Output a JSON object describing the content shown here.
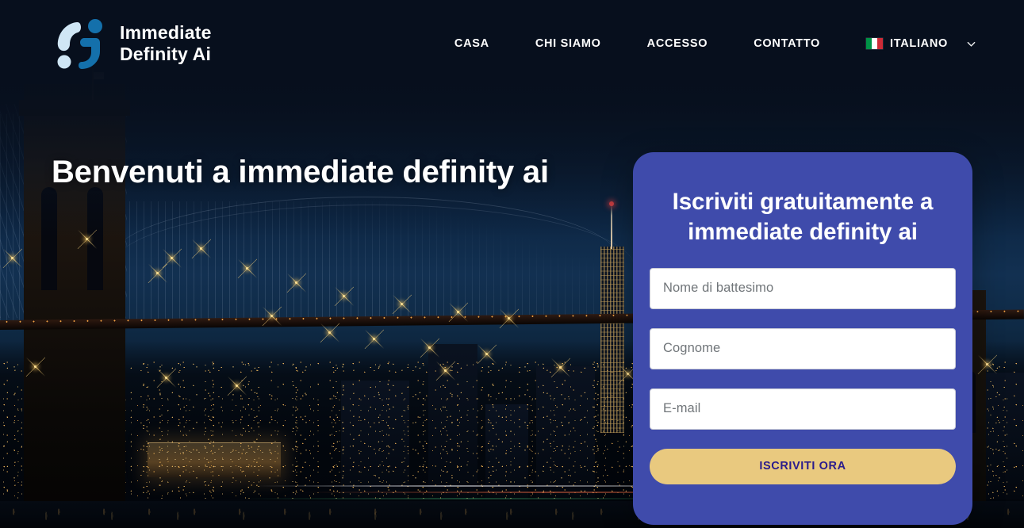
{
  "brand": {
    "name_line1": "Immediate",
    "name_line2": "Definity Ai",
    "logo_icon": "immediate-definity-logo-icon"
  },
  "nav": {
    "items": [
      {
        "label": "CASA",
        "name": "nav-item-casa"
      },
      {
        "label": "CHI SIAMO",
        "name": "nav-item-chi-siamo"
      },
      {
        "label": "ACCESSO",
        "name": "nav-item-accesso"
      },
      {
        "label": "CONTATTO",
        "name": "nav-item-contatto"
      }
    ],
    "language": {
      "label": "ITALIANO",
      "flag_icon": "italian-flag-icon",
      "chevron_icon": "chevron-down-icon"
    }
  },
  "hero": {
    "title": "Benvenuti a immediate definity ai",
    "background_image": "new-york-brooklyn-bridge-night-skyline"
  },
  "signup": {
    "title": "Iscriviti gratuitamente a immediate definity ai",
    "fields": [
      {
        "placeholder": "Nome di battesimo",
        "value": "",
        "name": "first-name-field"
      },
      {
        "placeholder": "Cognome",
        "value": "",
        "name": "last-name-field"
      },
      {
        "placeholder": "E-mail",
        "value": "",
        "name": "email-field"
      }
    ],
    "cta_label": "ISCRIVITI ORA"
  },
  "colors": {
    "header_background": "#070f1d",
    "card_background": "#3f4bab",
    "cta_background": "#e9c97f",
    "cta_text": "#2a1b8c",
    "logo_light": "#cfe6f5",
    "logo_dark": "#1470ab",
    "text_light": "#ffffff",
    "placeholder_text": "#707579",
    "flag_green": "#009246",
    "flag_white": "#ffffff",
    "flag_red": "#ce2b37"
  }
}
